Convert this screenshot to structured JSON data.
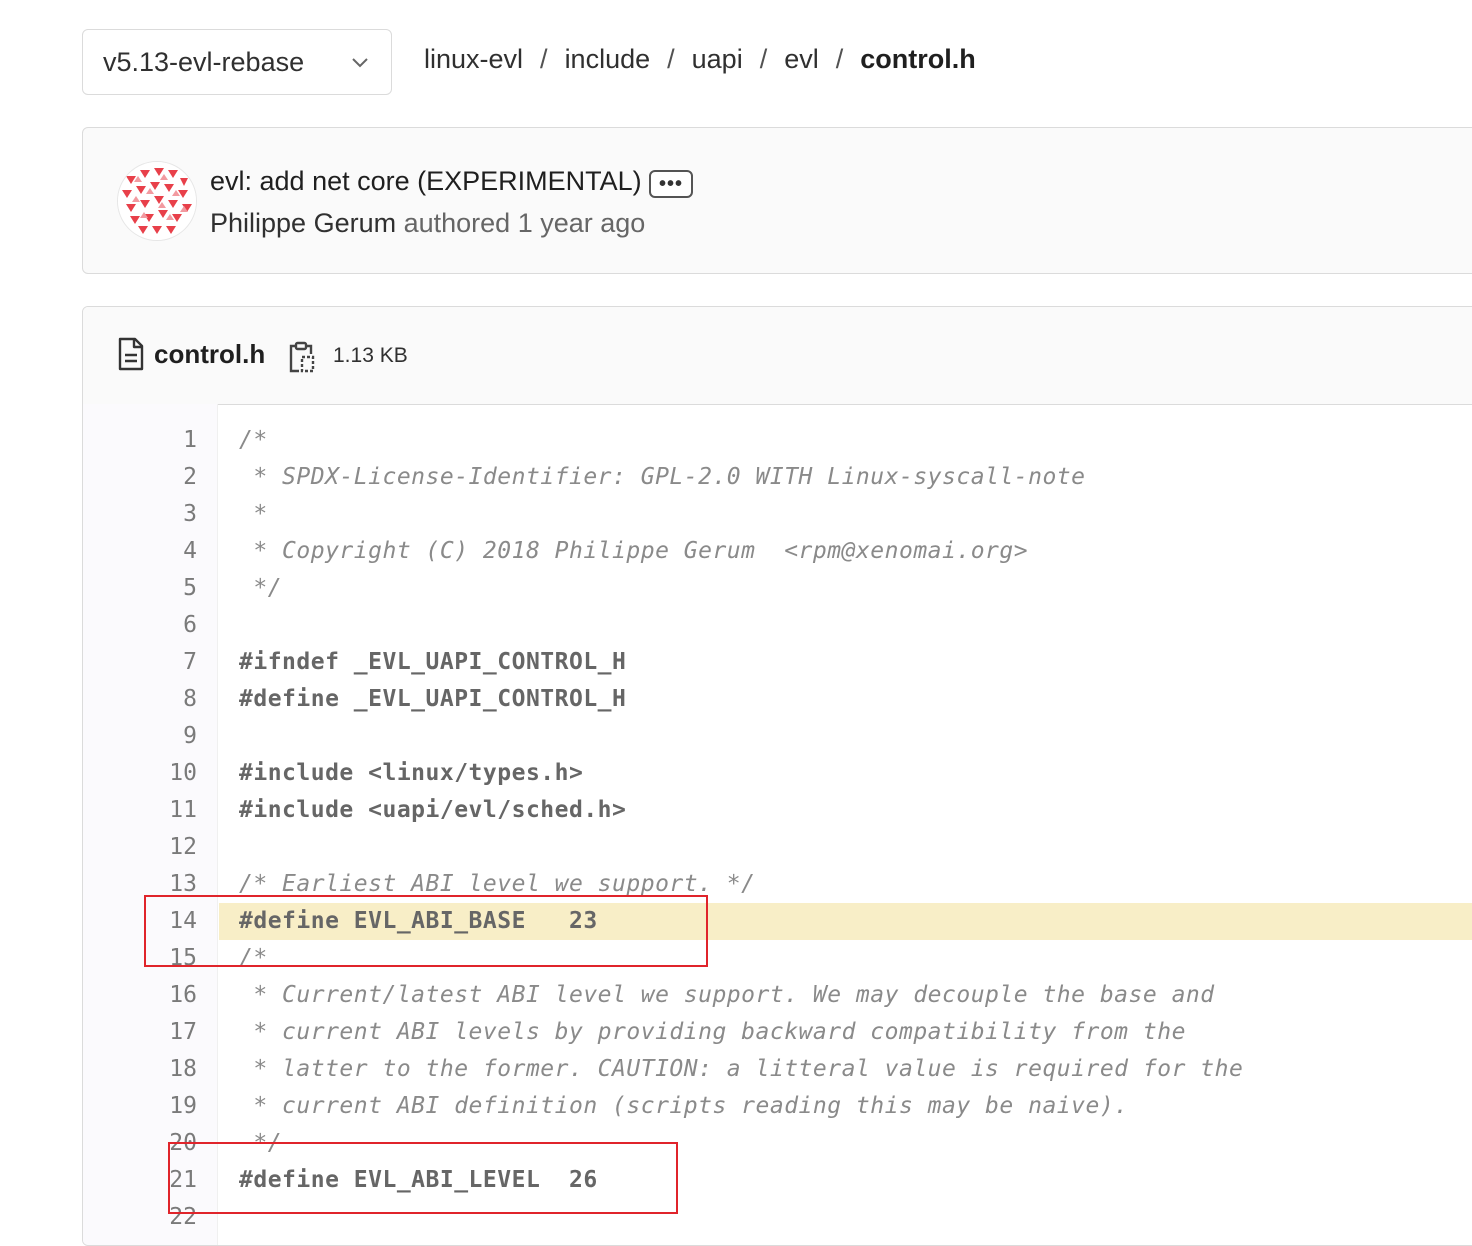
{
  "branch_selector": {
    "label": "v5.13-evl-rebase",
    "icon": "chevron-down-icon"
  },
  "breadcrumb": {
    "items": [
      "linux-evl",
      "include",
      "uapi",
      "evl"
    ],
    "current": "control.h",
    "separator": "/"
  },
  "commit": {
    "title": "evl: add net core (EXPERIMENTAL)",
    "ellipsis": "•••",
    "author": "Philippe Gerum",
    "action": "authored",
    "time": "1 year ago"
  },
  "file": {
    "name": "control.h",
    "size": "1.13 KB",
    "icon": "file-icon",
    "copy_icon": "clipboard-icon"
  },
  "code": {
    "highlighted_line": 14,
    "lines": [
      {
        "n": "1",
        "text": "/*",
        "kind": "comment"
      },
      {
        "n": "2",
        "text": " * SPDX-License-Identifier: GPL-2.0 WITH Linux-syscall-note",
        "kind": "comment"
      },
      {
        "n": "3",
        "text": " *",
        "kind": "comment"
      },
      {
        "n": "4",
        "text": " * Copyright (C) 2018 Philippe Gerum  <rpm@xenomai.org>",
        "kind": "comment"
      },
      {
        "n": "5",
        "text": " */",
        "kind": "comment"
      },
      {
        "n": "6",
        "text": "",
        "kind": "plain"
      },
      {
        "n": "7",
        "text": "#ifndef _EVL_UAPI_CONTROL_H",
        "kind": "preproc"
      },
      {
        "n": "8",
        "text": "#define _EVL_UAPI_CONTROL_H",
        "kind": "preproc"
      },
      {
        "n": "9",
        "text": "",
        "kind": "plain"
      },
      {
        "n": "10",
        "text": "#include <linux/types.h>",
        "kind": "preproc"
      },
      {
        "n": "11",
        "text": "#include <uapi/evl/sched.h>",
        "kind": "preproc"
      },
      {
        "n": "12",
        "text": "",
        "kind": "plain"
      },
      {
        "n": "13",
        "text": "/* Earliest ABI level we support. */",
        "kind": "comment"
      },
      {
        "n": "14",
        "text": "#define EVL_ABI_BASE   23",
        "kind": "preproc"
      },
      {
        "n": "15",
        "text": "/*",
        "kind": "comment"
      },
      {
        "n": "16",
        "text": " * Current/latest ABI level we support. We may decouple the base and",
        "kind": "comment"
      },
      {
        "n": "17",
        "text": " * current ABI levels by providing backward compatibility from the",
        "kind": "comment"
      },
      {
        "n": "18",
        "text": " * latter to the former. CAUTION: a litteral value is required for the",
        "kind": "comment"
      },
      {
        "n": "19",
        "text": " * current ABI definition (scripts reading this may be naive).",
        "kind": "comment"
      },
      {
        "n": "20",
        "text": " */",
        "kind": "comment"
      },
      {
        "n": "21",
        "text": "#define EVL_ABI_LEVEL  26",
        "kind": "preproc"
      },
      {
        "n": "22",
        "text": "",
        "kind": "plain"
      }
    ]
  },
  "annotations": {
    "box_color": "#e0242b",
    "highlight_color": "#f8eec7",
    "boxed_lines": [
      14,
      21
    ]
  }
}
